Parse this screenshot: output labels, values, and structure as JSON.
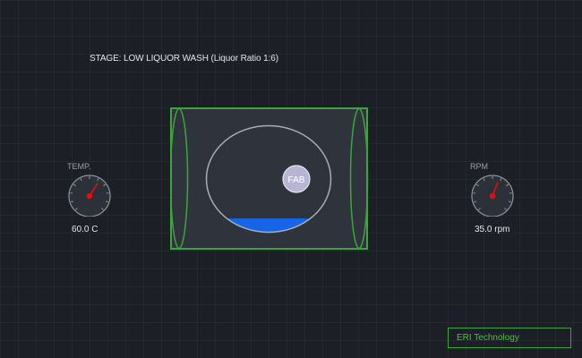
{
  "stage": {
    "label": "STAGE: LOW LIQUOR WASH (Liquor Ratio 1:6)"
  },
  "temperature_gauge": {
    "label": "TEMP.",
    "value_text": "60.0 C",
    "needle_fraction": 0.62
  },
  "rpm_gauge": {
    "label": "RPM",
    "value_text": "35.0 rpm",
    "needle_fraction": 0.58
  },
  "machine": {
    "fabric_label": "FAB",
    "liquor_level_fraction": 0.13,
    "frame_color": "#3fa33f",
    "liquor_color": "#1565e6"
  },
  "footer": {
    "company": "ERI Technology"
  },
  "colors": {
    "background": "#1c1f26",
    "accent_green": "#3fa33f",
    "needle_red": "#e01010",
    "liquor_blue": "#1565e6"
  },
  "icons": [
    "temperature-dial-icon",
    "rpm-dial-icon",
    "fabric-roll-icon"
  ]
}
